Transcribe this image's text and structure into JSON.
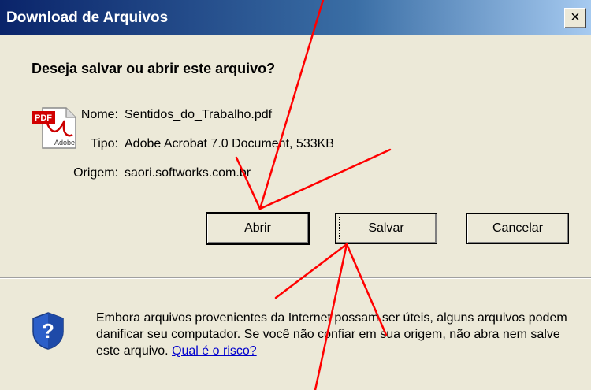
{
  "window": {
    "title": "Download de Arquivos",
    "close_glyph": "×"
  },
  "dialog": {
    "question": "Deseja salvar ou abrir este arquivo?",
    "file_icon": {
      "name": "pdf-icon",
      "badge": "PDF",
      "brand": "Adobe"
    },
    "fields": [
      {
        "label": "Nome:",
        "value": "Sentidos_do_Trabalho.pdf"
      },
      {
        "label": "Tipo:",
        "value": "Adobe Acrobat 7.0 Document, 533KB"
      },
      {
        "label": "Origem:",
        "value": "saori.softworks.com.br"
      }
    ],
    "buttons": {
      "open": "Abrir",
      "save": "Salvar",
      "cancel": "Cancelar"
    }
  },
  "warning": {
    "icon": "shield-question-icon",
    "text": "Embora arquivos provenientes da Internet possam ser úteis, alguns arquivos podem danificar seu computador. Se você não confiar em sua origem, não abra nem salve este arquivo.",
    "link": "Qual é o risco?"
  },
  "colors": {
    "title_bar": "#0a246a",
    "dialog_bg": "#ece9d8",
    "annotation": "#ff0000",
    "link": "#0000cc"
  }
}
